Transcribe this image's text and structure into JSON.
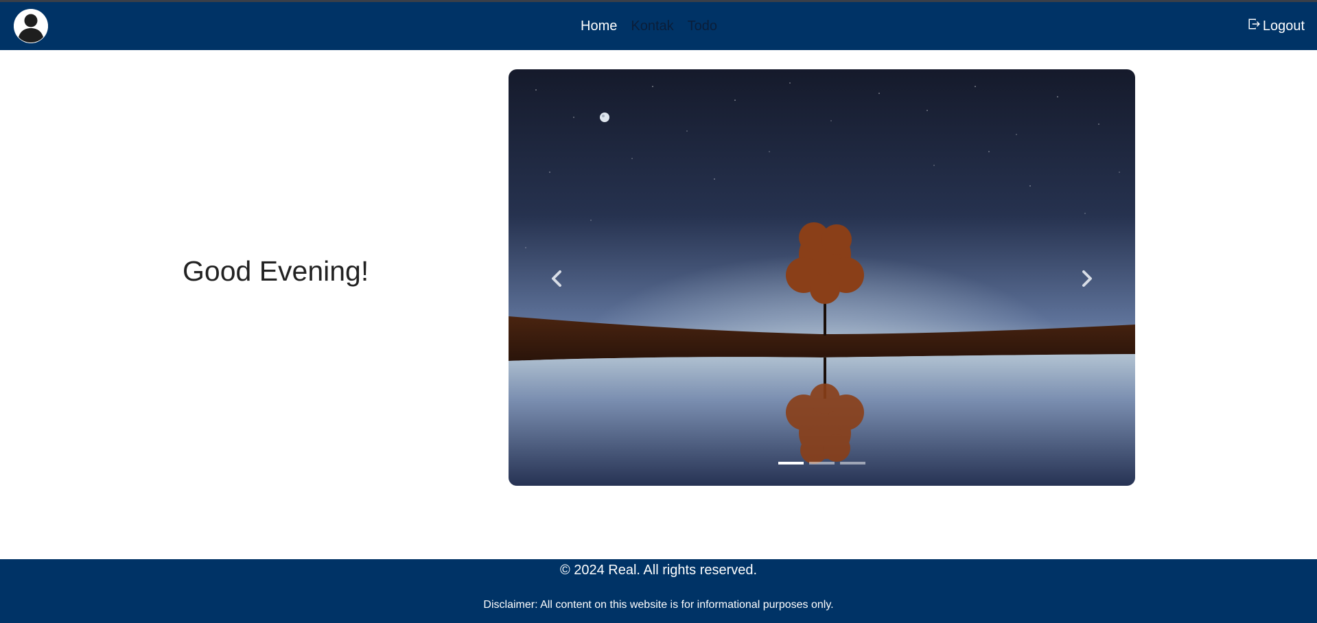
{
  "nav": {
    "links": [
      {
        "label": "Home",
        "active": true
      },
      {
        "label": "Kontak",
        "active": false
      },
      {
        "label": "Todo",
        "active": false
      }
    ],
    "logout_label": "Logout",
    "avatar_icon": "user-avatar-icon",
    "logout_icon": "box-arrow-right-icon"
  },
  "main": {
    "greeting": "Good Evening!"
  },
  "carousel": {
    "slide_count": 3,
    "active_index": 0,
    "prev_icon": "chevron-left-icon",
    "next_icon": "chevron-right-icon"
  },
  "footer": {
    "copyright": "© 2024 Real. All rights reserved.",
    "disclaimer": "Disclaimer: All content on this website is for informational purposes only."
  },
  "colors": {
    "navbar": "#003366",
    "footer": "#003366",
    "active_link": "#ffffff",
    "inactive_link": "#0a1e3a"
  }
}
